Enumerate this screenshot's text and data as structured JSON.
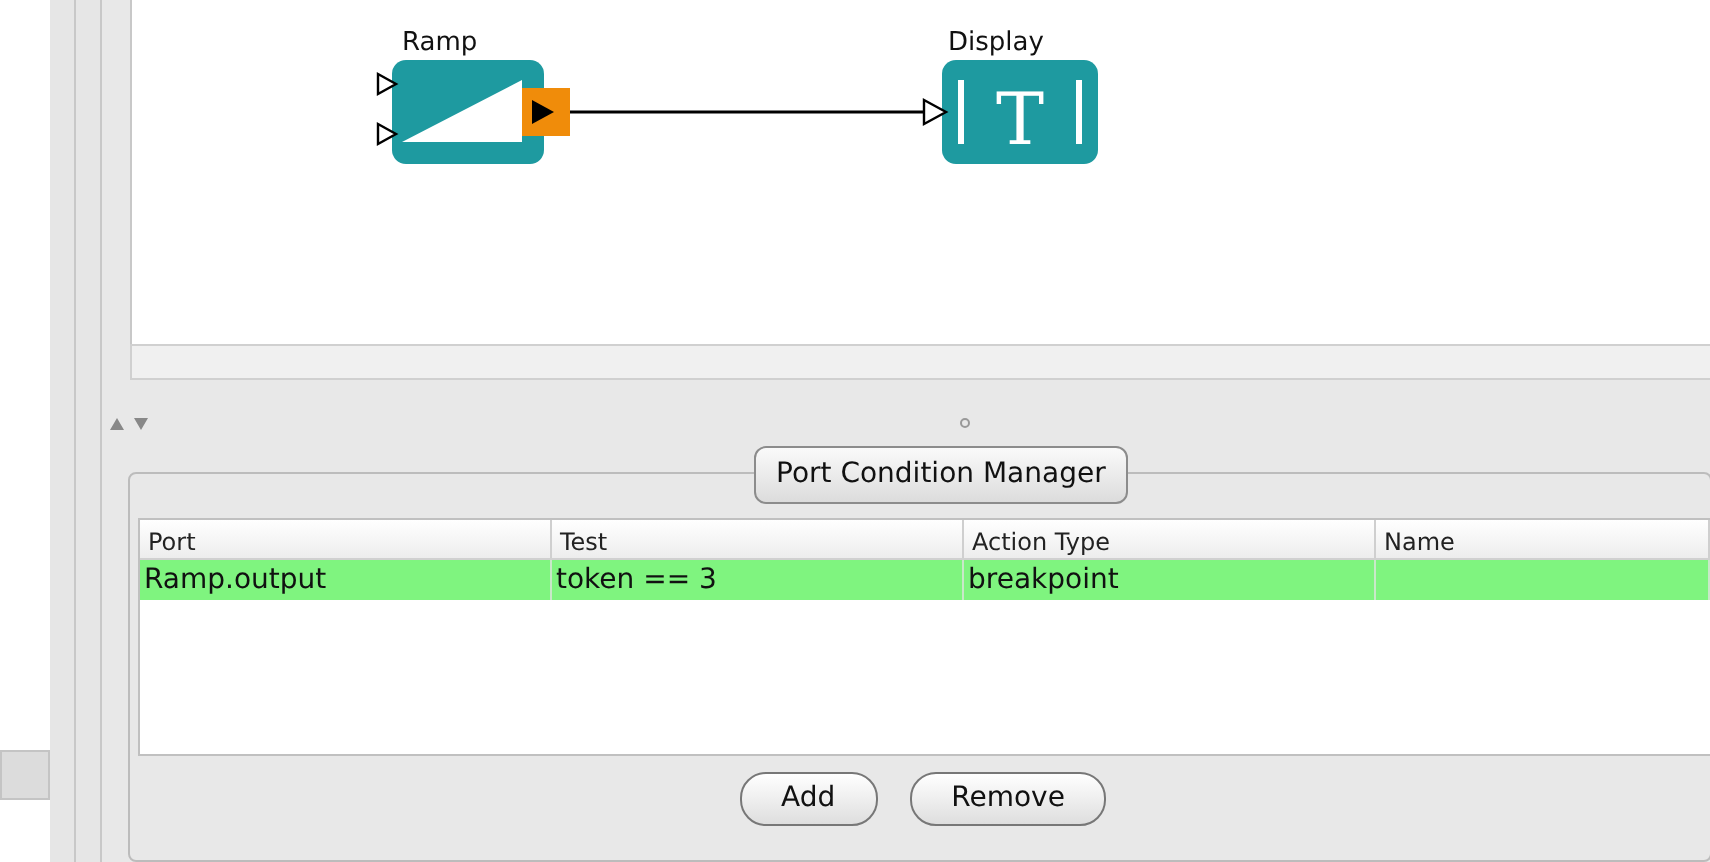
{
  "diagram": {
    "nodes": [
      {
        "label": "Ramp",
        "kind": "ramp",
        "output_highlighted": true
      },
      {
        "label": "Display",
        "kind": "display",
        "glyph": "T"
      }
    ]
  },
  "panel": {
    "title": "Port Condition Manager",
    "table": {
      "columns": [
        "Port",
        "Test",
        "Action Type",
        "Name"
      ],
      "rows": [
        {
          "cells": [
            "Ramp.output",
            "token == 3",
            "breakpoint"
          ],
          "selected": true
        }
      ]
    },
    "buttons": [
      "Add",
      "Remove"
    ]
  }
}
